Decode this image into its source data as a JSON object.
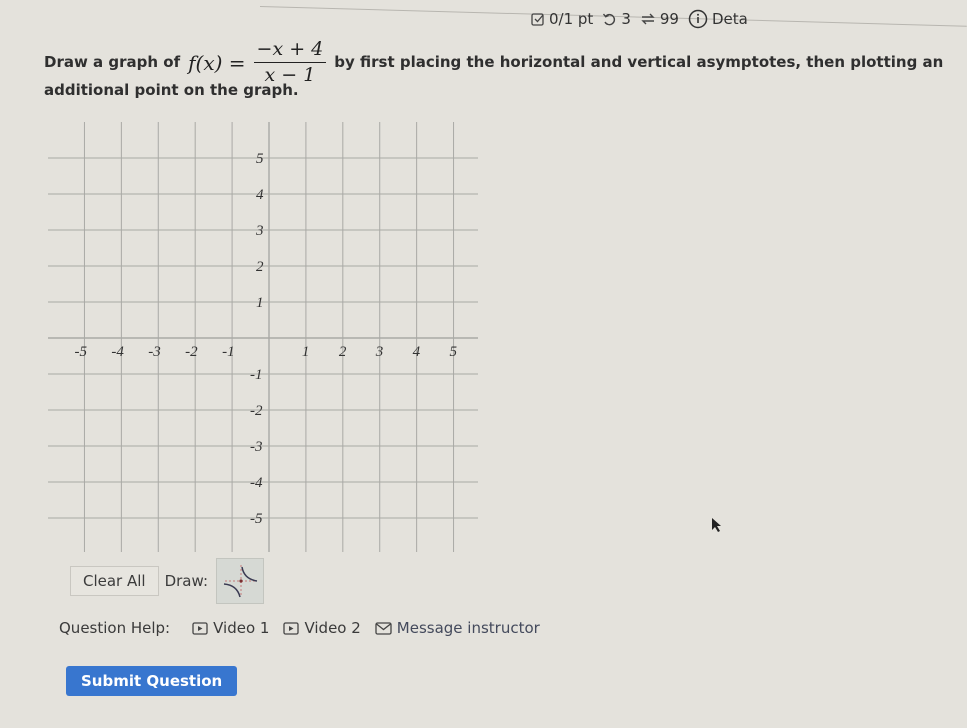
{
  "status": {
    "score": "0/1 pt",
    "retries": "3",
    "attempts": "99",
    "details": "Deta"
  },
  "question": {
    "prefix": "Draw a graph of",
    "function_lhs": "f(x) =",
    "numerator": "−x + 4",
    "denominator": "x − 1",
    "suffix": "by first placing the horizontal and vertical asymptotes, then plotting an",
    "line2": "additional point on the graph."
  },
  "graph": {
    "x_range": [
      -5,
      5
    ],
    "y_range": [
      -5,
      5
    ],
    "x_ticks": [
      "-5",
      "-4",
      "-3",
      "-2",
      "-1",
      "1",
      "2",
      "3",
      "4",
      "5"
    ],
    "y_ticks": [
      "5",
      "4",
      "3",
      "2",
      "1",
      "-1",
      "-2",
      "-3",
      "-4",
      "-5"
    ],
    "grid_color": "#a9a9a5"
  },
  "tools": {
    "clear_label": "Clear All",
    "draw_label": "Draw:",
    "draw_tool": "rational-function-tool"
  },
  "help": {
    "label": "Question Help:",
    "video1": "Video 1",
    "video2": "Video 2",
    "message": "Message instructor"
  },
  "submit_label": "Submit Question",
  "colors": {
    "accent": "#3876cf",
    "background": "#e4e2dc"
  }
}
